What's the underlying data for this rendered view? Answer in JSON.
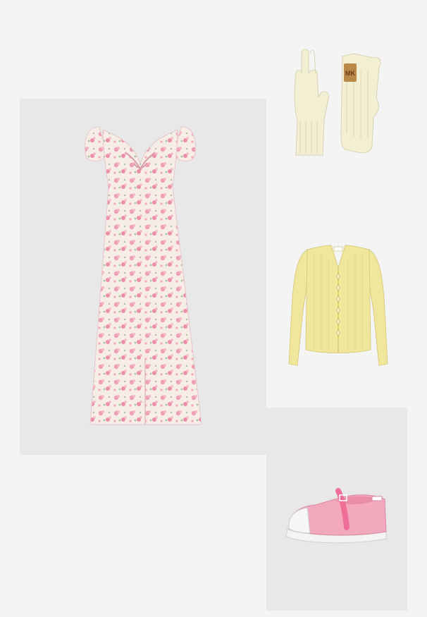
{
  "board": {
    "background": "#f4f4f4",
    "tile_background": "#e8e8e8"
  },
  "products": [
    {
      "id": "dress",
      "icon": "floral-midi-dress-image",
      "color": "#f3c9d4",
      "print": "floral"
    },
    {
      "id": "gloves",
      "icon": "knit-gloves-image",
      "color": "#f3efd2",
      "logo_text": "MK"
    },
    {
      "id": "cardigan",
      "icon": "ribbed-cardigan-image",
      "color": "#f1e79c"
    },
    {
      "id": "shoe",
      "icon": "mary-jane-sneaker-image",
      "color": "#f3a9bd"
    }
  ]
}
